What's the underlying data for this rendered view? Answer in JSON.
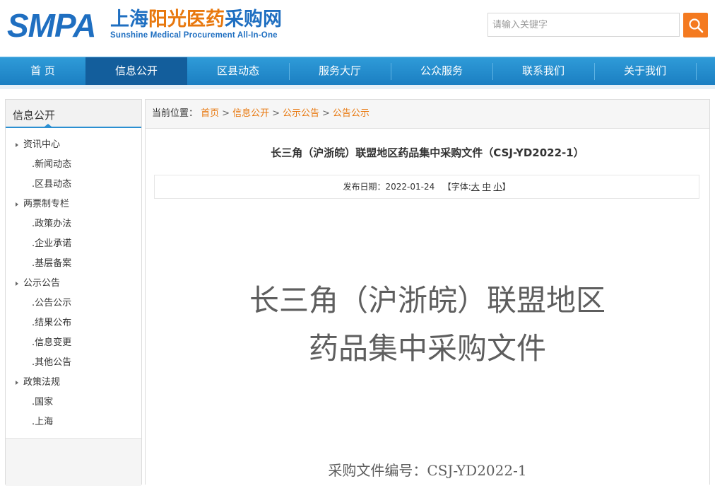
{
  "header": {
    "logo_smpa": "SMPA",
    "logo_cn_part1": "上海",
    "logo_cn_part2": "阳光医药",
    "logo_cn_part3": "采购网",
    "logo_en": "Sunshine Medical Procurement All-In-One",
    "search_placeholder": "请输入关键字"
  },
  "nav": {
    "items": [
      {
        "label": "首 页"
      },
      {
        "label": "信息公开"
      },
      {
        "label": "区县动态"
      },
      {
        "label": "服务大厅"
      },
      {
        "label": "公众服务"
      },
      {
        "label": "联系我们"
      },
      {
        "label": "关于我们"
      }
    ],
    "active_index": 1
  },
  "sidebar": {
    "title": "信息公开",
    "items": [
      {
        "label": "资讯中心",
        "type": "cat"
      },
      {
        "label": ".新闻动态",
        "type": "sub"
      },
      {
        "label": ".区县动态",
        "type": "sub"
      },
      {
        "label": "两票制专栏",
        "type": "cat"
      },
      {
        "label": ".政策办法",
        "type": "sub"
      },
      {
        "label": ".企业承诺",
        "type": "sub"
      },
      {
        "label": ".基层备案",
        "type": "sub"
      },
      {
        "label": "公示公告",
        "type": "cat"
      },
      {
        "label": ".公告公示",
        "type": "sub"
      },
      {
        "label": ".结果公布",
        "type": "sub"
      },
      {
        "label": ".信息变更",
        "type": "sub"
      },
      {
        "label": ".其他公告",
        "type": "sub"
      },
      {
        "label": "政策法规",
        "type": "cat"
      },
      {
        "label": ".国家",
        "type": "sub"
      },
      {
        "label": ".上海",
        "type": "sub"
      }
    ]
  },
  "breadcrumb": {
    "label": "当前位置：",
    "links": [
      "首页",
      "信息公开",
      "公示公告",
      "公告公示"
    ],
    "separator": ">"
  },
  "article": {
    "title": "长三角（沪浙皖）联盟地区药品集中采购文件（CSJ-YD2022-1）",
    "date_label": "发布日期：",
    "date": "2022-01-24",
    "font_label_open": "【字体:",
    "font_large": "大",
    "font_medium": "中",
    "font_small": "小",
    "font_label_close": "】",
    "big_title_line1": "长三角（沪浙皖）联盟地区",
    "big_title_line2": "药品集中采购文件",
    "doc_number": "采购文件编号：CSJ-YD2022-1"
  },
  "colors": {
    "brand_blue": "#1f6fc1",
    "brand_orange": "#e8780e",
    "nav_active": "#135e9c",
    "search_button": "#f47a20"
  }
}
